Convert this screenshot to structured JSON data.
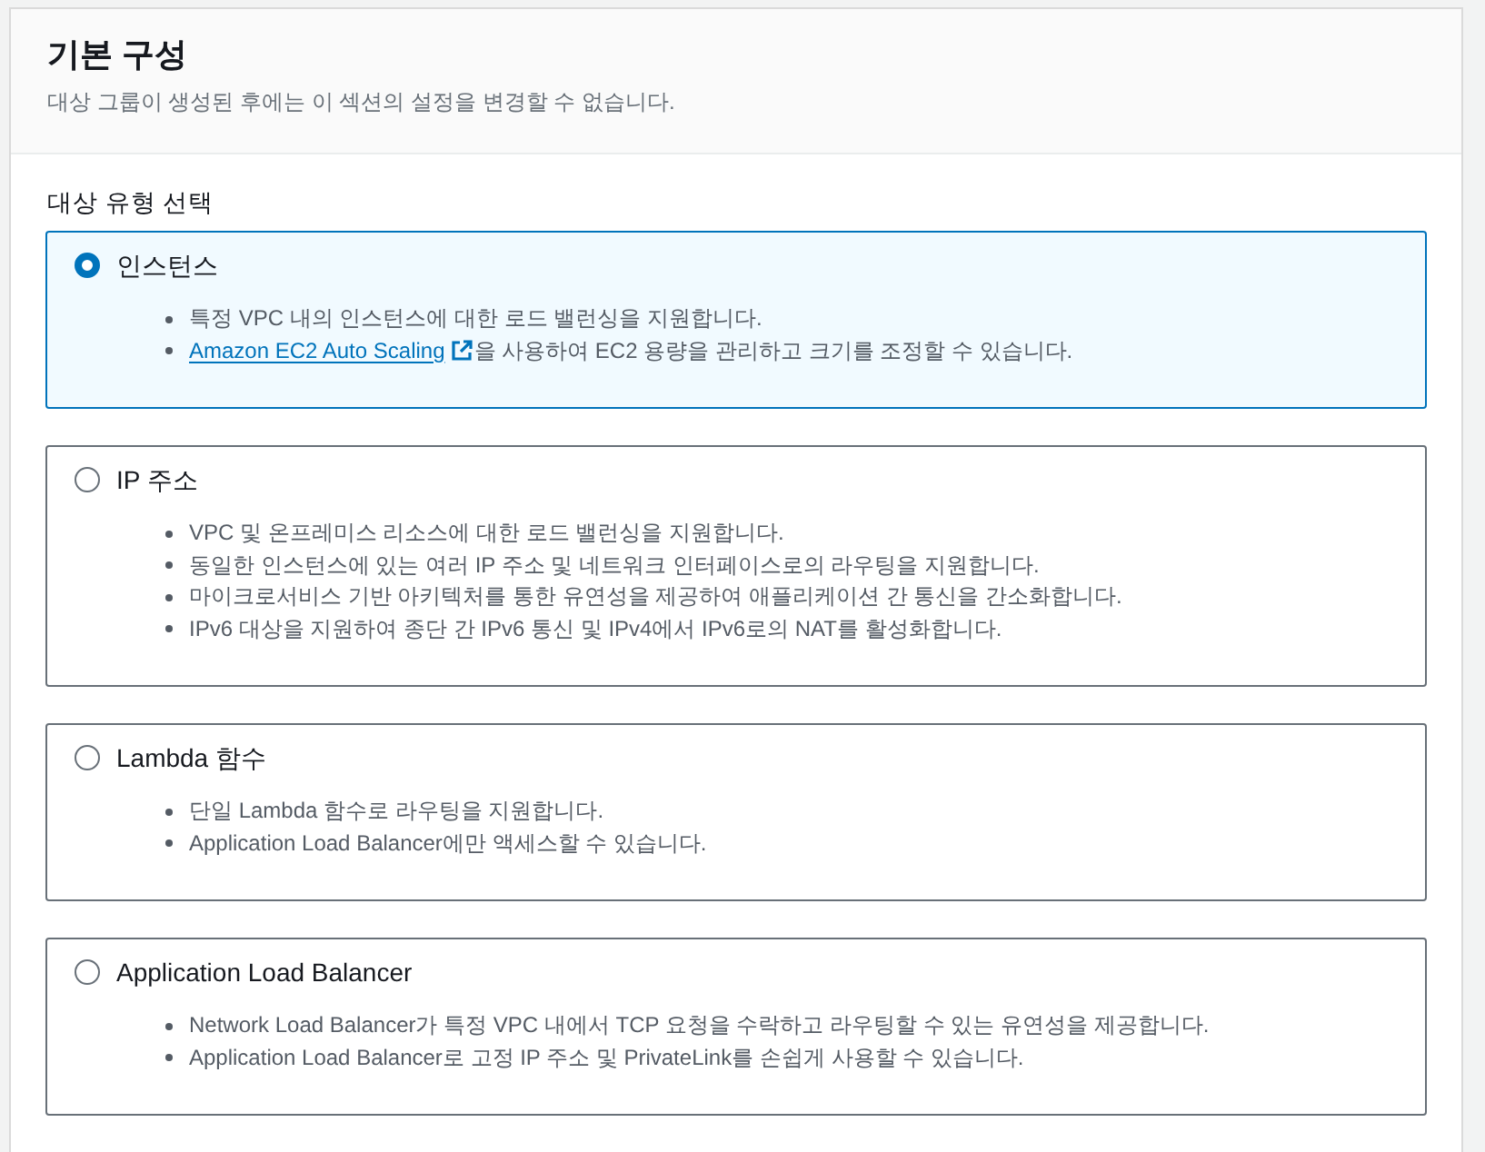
{
  "panel": {
    "title": "기본 구성",
    "description": "대상 그룹이 생성된 후에는 이 섹션의 설정을 변경할 수 없습니다."
  },
  "target_type": {
    "label": "대상 유형 선택",
    "options": [
      {
        "label": "인스턴스",
        "selected": true,
        "bullets": [
          {
            "kind": "text",
            "text": "특정 VPC 내의 인스턴스에 대한 로드 밸런싱을 지원합니다."
          },
          {
            "kind": "link",
            "link": "Amazon EC2 Auto Scaling",
            "text": "을 사용하여 EC2 용량을 관리하고 크기를 조정할 수 있습니다."
          }
        ]
      },
      {
        "label": "IP 주소",
        "selected": false,
        "bullets": [
          {
            "kind": "text",
            "text": "VPC 및 온프레미스 리소스에 대한 로드 밸런싱을 지원합니다."
          },
          {
            "kind": "text",
            "text": "동일한 인스턴스에 있는 여러 IP 주소 및 네트워크 인터페이스로의 라우팅을 지원합니다."
          },
          {
            "kind": "text",
            "text": "마이크로서비스 기반 아키텍처를 통한 유연성을 제공하여 애플리케이션 간 통신을 간소화합니다."
          },
          {
            "kind": "text",
            "text": "IPv6 대상을 지원하여 종단 간 IPv6 통신 및 IPv4에서 IPv6로의 NAT를 활성화합니다."
          }
        ]
      },
      {
        "label": "Lambda 함수",
        "selected": false,
        "bullets": [
          {
            "kind": "text",
            "text": "단일 Lambda 함수로 라우팅을 지원합니다."
          },
          {
            "kind": "text",
            "text": "Application Load Balancer에만 액세스할 수 있습니다."
          }
        ]
      },
      {
        "label": "Application Load Balancer",
        "selected": false,
        "bullets": [
          {
            "kind": "text",
            "text": "Network Load Balancer가 특정 VPC 내에서 TCP 요청을 수락하고 라우팅할 수 있는 유연성을 제공합니다."
          },
          {
            "kind": "text",
            "text": "Application Load Balancer로 고정 IP 주소 및 PrivateLink를 손쉽게 사용할 수 있습니다."
          }
        ]
      }
    ]
  }
}
